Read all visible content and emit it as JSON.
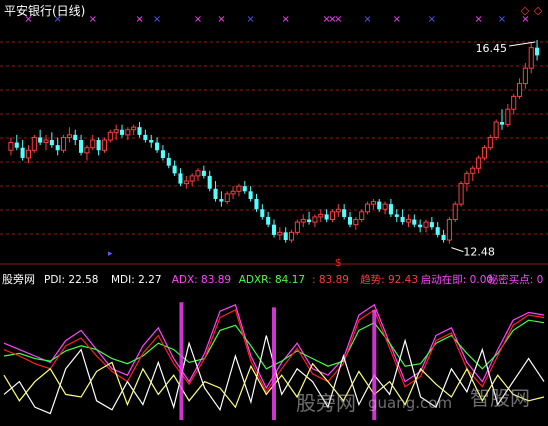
{
  "colors": {
    "background": "#000000",
    "grid": "#8b1a1a",
    "up_candle": "#ff3c3c",
    "down_candle": "#54ffff",
    "title": "#ffffff",
    "marker_magenta": "#ff44ff",
    "marker_blue": "#5a5aff",
    "dollar_red": "#ff2020",
    "pdi": "#ffffff",
    "mdi": "#ffffff",
    "adx": "#ff44ff",
    "adxr": "#44ff44",
    "extra": "#ff3c3c",
    "trend": "#ff3c3c",
    "startup": "#ff44ff",
    "secret": "#ff44ff",
    "line_white": "#ffffff",
    "line_yellow": "#ffff80",
    "line_magenta": "#ff44ff",
    "line_green": "#44ff44",
    "line_red": "#ff2020",
    "diamond": "#ff3c3c",
    "watermark": "#c8c8c8"
  },
  "chart_data": [
    {
      "type": "candlestick",
      "title": "平安银行(日线)",
      "annotations": [
        {
          "label": "16.45",
          "kind": "high"
        },
        {
          "label": "12.48",
          "kind": "low"
        }
      ],
      "top_marker_glyph": "×",
      "bottom_marker_glyph": "$",
      "arrow_glyph": "▸",
      "diamond_glyph": "◇",
      "ylim": [
        12.2,
        16.8
      ],
      "candles": [
        [
          14.3,
          14.55,
          14.2,
          14.45
        ],
        [
          14.45,
          14.6,
          14.3,
          14.35
        ],
        [
          14.35,
          14.5,
          14.1,
          14.15
        ],
        [
          14.15,
          14.4,
          14.05,
          14.3
        ],
        [
          14.3,
          14.6,
          14.25,
          14.55
        ],
        [
          14.55,
          14.7,
          14.4,
          14.45
        ],
        [
          14.45,
          14.6,
          14.3,
          14.5
        ],
        [
          14.5,
          14.65,
          14.35,
          14.4
        ],
        [
          14.4,
          14.55,
          14.2,
          14.3
        ],
        [
          14.3,
          14.6,
          14.25,
          14.55
        ],
        [
          14.55,
          14.75,
          14.45,
          14.6
        ],
        [
          14.6,
          14.7,
          14.4,
          14.5
        ],
        [
          14.5,
          14.6,
          14.2,
          14.25
        ],
        [
          14.25,
          14.4,
          14.1,
          14.35
        ],
        [
          14.35,
          14.6,
          14.3,
          14.5
        ],
        [
          14.5,
          14.55,
          14.2,
          14.3
        ],
        [
          14.3,
          14.55,
          14.25,
          14.5
        ],
        [
          14.5,
          14.7,
          14.45,
          14.65
        ],
        [
          14.65,
          14.8,
          14.5,
          14.7
        ],
        [
          14.7,
          14.8,
          14.55,
          14.6
        ],
        [
          14.6,
          14.75,
          14.5,
          14.7
        ],
        [
          14.7,
          14.8,
          14.6,
          14.75
        ],
        [
          14.75,
          14.85,
          14.55,
          14.6
        ],
        [
          14.6,
          14.7,
          14.45,
          14.5
        ],
        [
          14.5,
          14.6,
          14.35,
          14.45
        ],
        [
          14.45,
          14.55,
          14.25,
          14.3
        ],
        [
          14.3,
          14.4,
          14.1,
          14.15
        ],
        [
          14.15,
          14.25,
          13.95,
          14.0
        ],
        [
          14.0,
          14.1,
          13.8,
          13.85
        ],
        [
          13.85,
          13.95,
          13.6,
          13.65
        ],
        [
          13.65,
          13.8,
          13.55,
          13.7
        ],
        [
          13.7,
          13.85,
          13.6,
          13.8
        ],
        [
          13.8,
          13.95,
          13.7,
          13.9
        ],
        [
          13.9,
          14.0,
          13.75,
          13.8
        ],
        [
          13.8,
          13.9,
          13.5,
          13.55
        ],
        [
          13.55,
          13.7,
          13.3,
          13.35
        ],
        [
          13.35,
          13.5,
          13.2,
          13.3
        ],
        [
          13.3,
          13.5,
          13.25,
          13.45
        ],
        [
          13.45,
          13.6,
          13.35,
          13.5
        ],
        [
          13.5,
          13.65,
          13.4,
          13.6
        ],
        [
          13.6,
          13.7,
          13.45,
          13.5
        ],
        [
          13.5,
          13.6,
          13.3,
          13.35
        ],
        [
          13.35,
          13.45,
          13.1,
          13.15
        ],
        [
          13.15,
          13.25,
          12.95,
          13.0
        ],
        [
          13.0,
          13.1,
          12.8,
          12.85
        ],
        [
          12.85,
          12.95,
          12.6,
          12.65
        ],
        [
          12.65,
          12.8,
          12.55,
          12.7
        ],
        [
          12.7,
          12.8,
          12.5,
          12.55
        ],
        [
          12.55,
          12.75,
          12.5,
          12.7
        ],
        [
          12.7,
          12.95,
          12.65,
          12.9
        ],
        [
          12.9,
          13.05,
          12.8,
          12.95
        ],
        [
          12.95,
          13.1,
          12.85,
          12.9
        ],
        [
          12.9,
          13.05,
          12.8,
          13.0
        ],
        [
          13.0,
          13.15,
          12.9,
          13.05
        ],
        [
          13.05,
          13.15,
          12.9,
          12.95
        ],
        [
          12.95,
          13.15,
          12.9,
          13.1
        ],
        [
          13.1,
          13.25,
          13.0,
          13.15
        ],
        [
          13.15,
          13.25,
          12.95,
          13.0
        ],
        [
          13.0,
          13.1,
          12.8,
          12.85
        ],
        [
          12.85,
          13.0,
          12.75,
          12.95
        ],
        [
          12.95,
          13.15,
          12.9,
          13.1
        ],
        [
          13.1,
          13.3,
          13.05,
          13.25
        ],
        [
          13.25,
          13.35,
          13.15,
          13.3
        ],
        [
          13.3,
          13.35,
          13.1,
          13.15
        ],
        [
          13.15,
          13.3,
          13.05,
          13.25
        ],
        [
          13.25,
          13.35,
          13.0,
          13.05
        ],
        [
          13.05,
          13.15,
          12.9,
          13.0
        ],
        [
          13.0,
          13.15,
          12.85,
          12.9
        ],
        [
          12.9,
          13.05,
          12.8,
          12.95
        ],
        [
          12.95,
          13.05,
          12.8,
          12.85
        ],
        [
          12.85,
          12.95,
          12.7,
          12.8
        ],
        [
          12.8,
          12.95,
          12.7,
          12.9
        ],
        [
          12.9,
          13.0,
          12.75,
          12.8
        ],
        [
          12.8,
          12.9,
          12.6,
          12.65
        ],
        [
          12.65,
          12.75,
          12.5,
          12.55
        ],
        [
          12.55,
          13.0,
          12.48,
          12.95
        ],
        [
          12.95,
          13.3,
          12.9,
          13.25
        ],
        [
          13.25,
          13.7,
          13.2,
          13.65
        ],
        [
          13.65,
          13.9,
          13.5,
          13.85
        ],
        [
          13.85,
          14.0,
          13.7,
          13.95
        ],
        [
          13.95,
          14.2,
          13.85,
          14.15
        ],
        [
          14.15,
          14.4,
          14.1,
          14.35
        ],
        [
          14.35,
          14.6,
          14.3,
          14.55
        ],
        [
          14.55,
          14.9,
          14.5,
          14.85
        ],
        [
          14.85,
          15.1,
          14.7,
          14.8
        ],
        [
          14.8,
          15.2,
          14.75,
          15.1
        ],
        [
          15.1,
          15.4,
          15.0,
          15.35
        ],
        [
          15.35,
          15.7,
          15.3,
          15.6
        ],
        [
          15.6,
          16.0,
          15.5,
          15.9
        ],
        [
          15.9,
          16.4,
          15.8,
          16.3
        ],
        [
          16.3,
          16.45,
          16.05,
          16.15
        ]
      ],
      "top_markers": [
        {
          "i": 3,
          "c": "marker_magenta"
        },
        {
          "i": 8,
          "c": "marker_blue"
        },
        {
          "i": 14,
          "c": "marker_magenta"
        },
        {
          "i": 22,
          "c": "marker_magenta"
        },
        {
          "i": 25,
          "c": "marker_blue"
        },
        {
          "i": 32,
          "c": "marker_magenta"
        },
        {
          "i": 36,
          "c": "marker_magenta"
        },
        {
          "i": 41,
          "c": "marker_blue"
        },
        {
          "i": 47,
          "c": "marker_magenta"
        },
        {
          "i": 54,
          "c": "marker_magenta"
        },
        {
          "i": 55,
          "c": "marker_magenta"
        },
        {
          "i": 56,
          "c": "marker_magenta"
        },
        {
          "i": 61,
          "c": "marker_blue"
        },
        {
          "i": 66,
          "c": "marker_magenta"
        },
        {
          "i": 72,
          "c": "marker_blue"
        },
        {
          "i": 80,
          "c": "marker_magenta"
        },
        {
          "i": 84,
          "c": "marker_blue"
        },
        {
          "i": 88,
          "c": "marker_magenta"
        }
      ],
      "dollar_marker_index": 56,
      "arrow_marker_index": 17
    },
    {
      "type": "line",
      "title": "股旁网",
      "legend": [
        {
          "label": "PDI:",
          "value": "22.58",
          "c": "pdi"
        },
        {
          "label": "MDI:",
          "value": "2.27",
          "c": "mdi"
        },
        {
          "label": "ADX:",
          "value": "83.89",
          "c": "adx"
        },
        {
          "label": "ADXR:",
          "value": "84.17",
          "c": "adxr"
        },
        {
          "label": ":",
          "value": "83.89",
          "c": "extra"
        },
        {
          "label": "趋势:",
          "value": "92.43",
          "c": "trend"
        },
        {
          "label": "启动在即:",
          "value": "0.00",
          "c": "startup"
        },
        {
          "label": "秘密买点:",
          "value": "0",
          "c": "secret"
        }
      ],
      "ylim": [
        0,
        100
      ],
      "x": [
        0,
        4,
        8,
        12,
        16,
        20,
        24,
        28,
        32,
        36,
        40,
        44,
        48,
        52,
        56,
        60,
        64,
        68,
        72,
        76,
        80,
        84,
        88,
        92,
        96,
        100,
        104,
        108,
        112,
        116,
        120,
        124,
        128,
        132,
        136,
        140
      ],
      "series": [
        {
          "c": "line_magenta",
          "values": [
            60,
            55,
            50,
            45,
            62,
            70,
            55,
            40,
            35,
            58,
            72,
            48,
            30,
            52,
            85,
            90,
            50,
            25,
            45,
            60,
            40,
            35,
            48,
            82,
            90,
            60,
            30,
            38,
            66,
            72,
            45,
            30,
            55,
            78,
            84,
            82
          ]
        },
        {
          "c": "line_green",
          "values": [
            50,
            52,
            48,
            46,
            54,
            58,
            55,
            48,
            44,
            50,
            60,
            55,
            45,
            48,
            70,
            74,
            58,
            40,
            46,
            54,
            48,
            42,
            46,
            70,
            76,
            60,
            42,
            44,
            60,
            66,
            52,
            40,
            52,
            70,
            78,
            76
          ]
        },
        {
          "c": "line_red",
          "values": [
            55,
            50,
            44,
            40,
            58,
            64,
            50,
            38,
            30,
            52,
            66,
            44,
            28,
            48,
            80,
            86,
            46,
            22,
            40,
            56,
            36,
            30,
            44,
            78,
            86,
            56,
            26,
            34,
            62,
            68,
            40,
            26,
            50,
            74,
            82,
            80
          ]
        },
        {
          "c": "line_white",
          "values": [
            20,
            30,
            10,
            5,
            40,
            55,
            15,
            8,
            30,
            12,
            45,
            10,
            60,
            25,
            8,
            50,
            14,
            66,
            20,
            40,
            30,
            10,
            50,
            12,
            35,
            20,
            62,
            18,
            10,
            40,
            22,
            55,
            12,
            30,
            48,
            30
          ]
        },
        {
          "c": "line_yellow",
          "values": [
            35,
            15,
            30,
            40,
            20,
            18,
            38,
            45,
            12,
            40,
            20,
            35,
            15,
            30,
            25,
            10,
            42,
            20,
            35,
            18,
            44,
            30,
            15,
            38,
            20,
            30,
            12,
            40,
            28,
            18,
            40,
            15,
            35,
            20,
            15,
            18
          ]
        }
      ],
      "spikes": [
        {
          "x": 46,
          "h": 92,
          "c": "line_magenta"
        },
        {
          "x": 70,
          "h": 88,
          "c": "line_magenta"
        },
        {
          "x": 96,
          "h": 86,
          "c": "line_magenta"
        }
      ],
      "watermark": [
        {
          "text": "股旁网"
        },
        {
          "text": "guang.com"
        },
        {
          "text": "智股网"
        }
      ],
      "diamonds_count": 2
    }
  ]
}
